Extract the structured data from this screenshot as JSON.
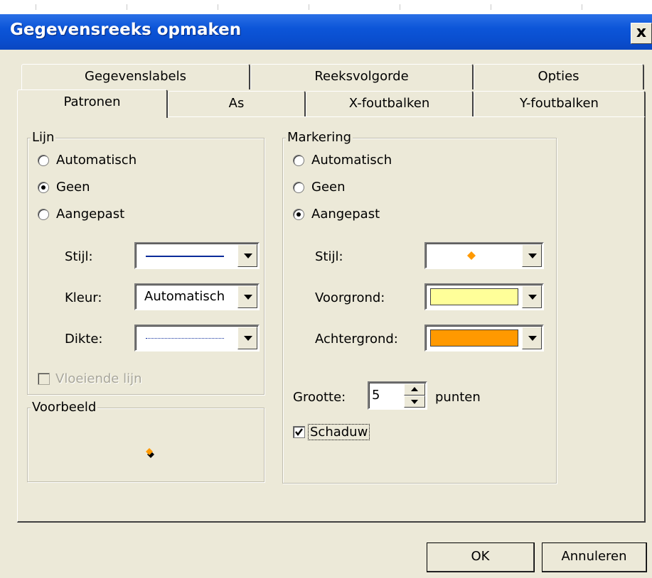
{
  "window": {
    "title": "Gegevensreeks opmaken",
    "close_label": "x"
  },
  "tabs_row1": [
    "Gegevenslabels",
    "Reeksvolgorde",
    "Opties"
  ],
  "tabs_row2": [
    "Patronen",
    "As",
    "X-foutbalken",
    "Y-foutbalken"
  ],
  "active_tab": "Patronen",
  "lijn": {
    "legend": "Lijn",
    "options": [
      "Automatisch",
      "Geen",
      "Aangepast"
    ],
    "selected": "Geen",
    "stijl_label": "Stijl:",
    "kleur_label": "Kleur:",
    "kleur_value": "Automatisch",
    "dikte_label": "Dikte:",
    "smooth_label": "Vloeiende lijn",
    "smooth_checked": false,
    "line_color": "#0a2a9a"
  },
  "voorbeeld": {
    "legend": "Voorbeeld"
  },
  "markering": {
    "legend": "Markering",
    "options": [
      "Automatisch",
      "Geen",
      "Aangepast"
    ],
    "selected": "Aangepast",
    "stijl_label": "Stijl:",
    "voorgrond_label": "Voorgrond:",
    "voorgrond_color": "#ffff99",
    "achtergrond_label": "Achtergrond:",
    "achtergrond_color": "#ff9900",
    "marker_color": "#ff9900",
    "grootte_label": "Grootte:",
    "grootte_value": "5",
    "grootte_unit": "punten",
    "schaduw_label": "Schaduw",
    "schaduw_checked": true
  },
  "buttons": {
    "ok": "OK",
    "cancel": "Annuleren"
  }
}
